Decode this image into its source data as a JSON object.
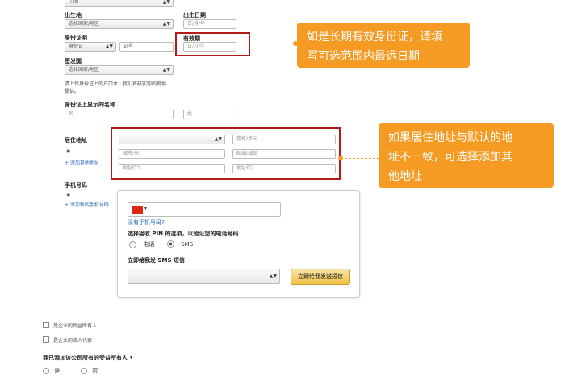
{
  "form": {
    "country_value": "中国",
    "birthplace_label": "出生地",
    "birthplace_select": "选择国家/地区",
    "birthdate_label": "出生日期",
    "birthdate_placeholder": "日/月/年",
    "id_label": "身份证明",
    "id_type_value": "身份证",
    "id_number_placeholder": "证号",
    "expiry_label": "有效期",
    "expiry_placeholder": "日/月/年",
    "issuer_label": "签发国",
    "issuer_select": "选择国家/地区",
    "note_line1": "请上传身份证上的户口本，我们将核实你的提供",
    "note_line2": "提供。",
    "name_on_id_label": "身份证上显示的名称",
    "name_first_placeholder": "名",
    "name_last_placeholder": "姓",
    "address_label": "居住地址",
    "address_building_placeholder": "楼栋/单元",
    "address_city_placeholder": "城市/州",
    "address_postcode_placeholder": "邮编/城镇",
    "address_line1_placeholder": "地址行1",
    "address_line2_placeholder": "地址行2",
    "add_address_link": "+ 添加其他地址",
    "phone_label": "手机号码",
    "add_phone_link": "+ 添加新的手机号码",
    "no_phone_link": "没有手机号码?",
    "pin_prompt": "选择接收 PIN 的选项，以验证您的电话号码",
    "option_call": "电话",
    "option_sms": "SMS",
    "sms_label": "立即给我发 SMS 短信",
    "send_button": "立即给我发送短信",
    "checkbox1": "是企业的受益所有人",
    "checkbox2": "是企业的法人代表",
    "question": "我已添加该公司所有的受益所有人 •",
    "answer_yes": "是",
    "answer_no": "否"
  },
  "callouts": {
    "expiry_line1": "如是长期有效身份证，请填",
    "expiry_line2": "写可选范围内最远日期",
    "address_line1": "如果居住地址与默认的地",
    "address_line2": "址不一致，可选择添加其",
    "address_line3": "他地址"
  },
  "colors": {
    "callout_bg": "#f59a23",
    "highlight_border": "#b31b1b",
    "link": "#2a6bb7"
  }
}
